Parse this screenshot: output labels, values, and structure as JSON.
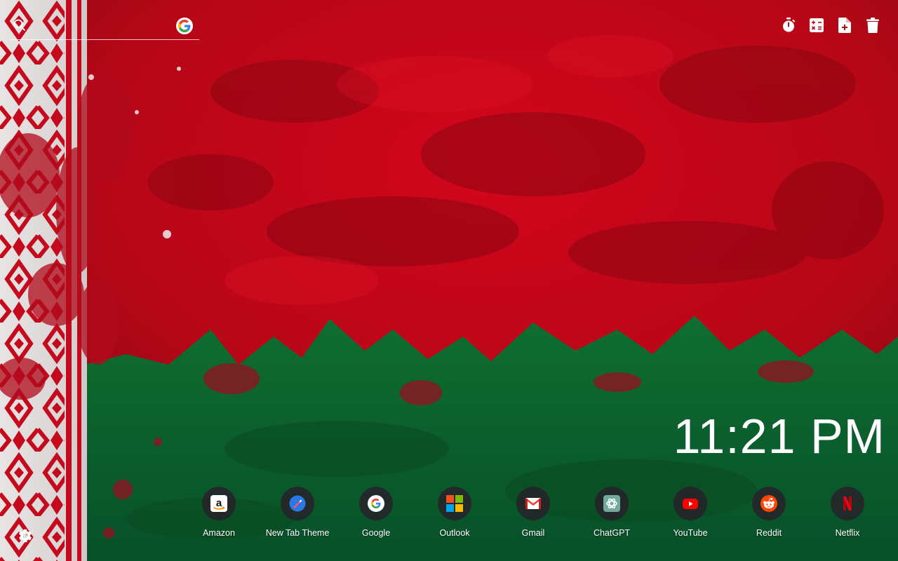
{
  "search": {
    "placeholder": "",
    "value": "",
    "engine_icon": "google-icon"
  },
  "toolbar": {
    "items": [
      {
        "name": "timer",
        "icon": "stopwatch-icon"
      },
      {
        "name": "calculator",
        "icon": "calculator-icon"
      },
      {
        "name": "new-note",
        "icon": "add-document-icon"
      },
      {
        "name": "trash",
        "icon": "trash-icon"
      }
    ]
  },
  "clock": {
    "time": "11:21 PM"
  },
  "shortcuts": [
    {
      "label": "Amazon",
      "icon": "amazon-icon"
    },
    {
      "label": "New Tab Theme",
      "icon": "new-tab-theme-icon"
    },
    {
      "label": "Google",
      "icon": "google-icon"
    },
    {
      "label": "Outlook",
      "icon": "microsoft-icon"
    },
    {
      "label": "Gmail",
      "icon": "gmail-icon"
    },
    {
      "label": "ChatGPT",
      "icon": "chatgpt-icon"
    },
    {
      "label": "YouTube",
      "icon": "youtube-icon"
    },
    {
      "label": "Reddit",
      "icon": "reddit-icon"
    },
    {
      "label": "Netflix",
      "icon": "netflix-icon"
    }
  ],
  "settings": {
    "icon": "gear-icon"
  },
  "colors": {
    "flag_red": "#c0061a",
    "flag_green": "#0d6a2c",
    "ornament_white": "#e8e3e3",
    "ornament_red": "#c40a1c"
  }
}
